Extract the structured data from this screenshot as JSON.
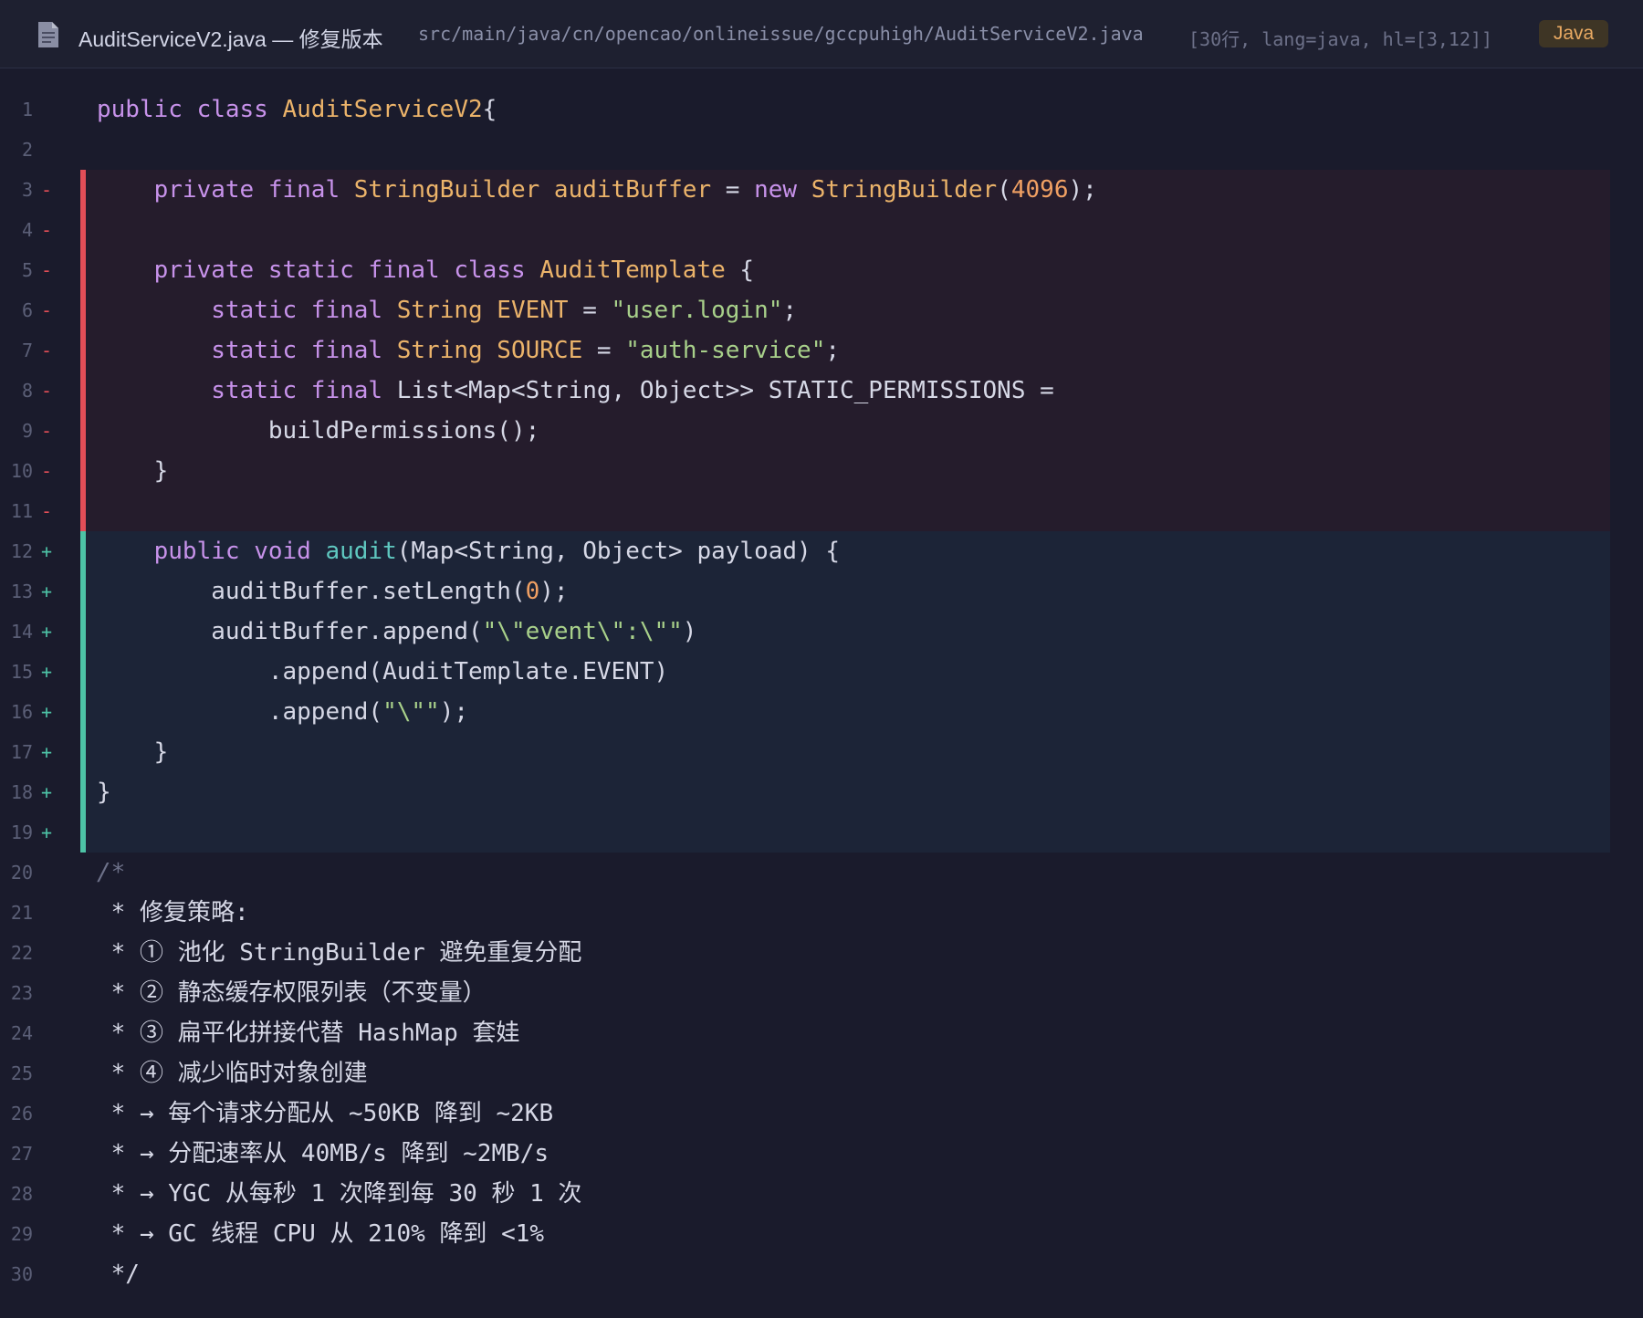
{
  "header": {
    "icon": "file-icon",
    "title": "AuditServiceV2.java — 修复版本",
    "path": "src/main/java/cn/opencao/onlineissue/gccpuhigh/AuditServiceV2.java",
    "meta": "[30行, lang=java, hl=[3,12]]",
    "language": "Java"
  },
  "colors": {
    "background": "#1a1b2c",
    "removed": "#e24e57",
    "added": "#4dc3a6",
    "keyword": "#c792ea",
    "type": "#ebb36a",
    "string": "#a8d08a"
  },
  "lines": [
    {
      "n": "1",
      "m": "",
      "kind": "ctx",
      "tokens": [
        [
          "kw",
          "public class "
        ],
        [
          "ty",
          "AuditServiceV2"
        ],
        [
          "",
          "{"
        ]
      ]
    },
    {
      "n": "2",
      "m": "",
      "kind": "ctx",
      "tokens": []
    },
    {
      "n": "3",
      "m": "-",
      "kind": "del",
      "tokens": [
        [
          "",
          "    "
        ],
        [
          "kw",
          "private final "
        ],
        [
          "ty",
          "StringBuilder auditBuffer"
        ],
        [
          "",
          " = "
        ],
        [
          "kw",
          "new "
        ],
        [
          "ty",
          "StringBuilder"
        ],
        [
          "",
          "("
        ],
        [
          "nu",
          "4096"
        ],
        [
          "",
          ");"
        ]
      ]
    },
    {
      "n": "4",
      "m": "-",
      "kind": "del",
      "tokens": []
    },
    {
      "n": "5",
      "m": "-",
      "kind": "del",
      "tokens": [
        [
          "",
          "    "
        ],
        [
          "kw",
          "private static final class "
        ],
        [
          "ty",
          "AuditTemplate"
        ],
        [
          "",
          " {"
        ]
      ]
    },
    {
      "n": "6",
      "m": "-",
      "kind": "del",
      "tokens": [
        [
          "",
          "        "
        ],
        [
          "kw",
          "static final "
        ],
        [
          "ty",
          "String EVENT"
        ],
        [
          "",
          " = "
        ],
        [
          "st",
          "\"user.login\""
        ],
        [
          "",
          ";"
        ]
      ]
    },
    {
      "n": "7",
      "m": "-",
      "kind": "del",
      "tokens": [
        [
          "",
          "        "
        ],
        [
          "kw",
          "static final "
        ],
        [
          "ty",
          "String SOURCE"
        ],
        [
          "",
          " = "
        ],
        [
          "st",
          "\"auth-service\""
        ],
        [
          "",
          ";"
        ]
      ]
    },
    {
      "n": "8",
      "m": "-",
      "kind": "del",
      "tokens": [
        [
          "",
          "        "
        ],
        [
          "kw",
          "static final "
        ],
        [
          "",
          "List<Map<String, Object>> STATIC_PERMISSIONS ="
        ]
      ]
    },
    {
      "n": "9",
      "m": "-",
      "kind": "del",
      "tokens": [
        [
          "",
          "            buildPermissions();"
        ]
      ]
    },
    {
      "n": "10",
      "m": "-",
      "kind": "del",
      "tokens": [
        [
          "",
          "    }"
        ]
      ]
    },
    {
      "n": "11",
      "m": "-",
      "kind": "del",
      "tokens": []
    },
    {
      "n": "12",
      "m": "+",
      "kind": "add",
      "tokens": [
        [
          "",
          "    "
        ],
        [
          "kw",
          "public void "
        ],
        [
          "fn",
          "audit"
        ],
        [
          "",
          "(Map<String, Object> payload) {"
        ]
      ]
    },
    {
      "n": "13",
      "m": "+",
      "kind": "add",
      "tokens": [
        [
          "",
          "        auditBuffer.setLength("
        ],
        [
          "nu",
          "0"
        ],
        [
          "",
          ");"
        ]
      ]
    },
    {
      "n": "14",
      "m": "+",
      "kind": "add",
      "tokens": [
        [
          "",
          "        auditBuffer.append("
        ],
        [
          "st",
          "\"\\\"event\\\":\\\"\""
        ],
        [
          "",
          ")"
        ]
      ]
    },
    {
      "n": "15",
      "m": "+",
      "kind": "add",
      "tokens": [
        [
          "",
          "            .append(AuditTemplate.EVENT)"
        ]
      ]
    },
    {
      "n": "16",
      "m": "+",
      "kind": "add",
      "tokens": [
        [
          "",
          "            .append("
        ],
        [
          "st",
          "\"\\\"\""
        ],
        [
          "",
          ");"
        ]
      ]
    },
    {
      "n": "17",
      "m": "+",
      "kind": "add",
      "tokens": [
        [
          "",
          "    }"
        ]
      ]
    },
    {
      "n": "18",
      "m": "+",
      "kind": "add",
      "tokens": [
        [
          "",
          "}"
        ]
      ]
    },
    {
      "n": "19",
      "m": "+",
      "kind": "add",
      "tokens": []
    },
    {
      "n": "20",
      "m": "",
      "kind": "ctx",
      "tokens": [
        [
          "cm",
          "/*"
        ]
      ]
    },
    {
      "n": "21",
      "m": "",
      "kind": "ctx",
      "tokens": [
        [
          "ct",
          " * 修复策略:"
        ]
      ]
    },
    {
      "n": "22",
      "m": "",
      "kind": "ctx",
      "tokens": [
        [
          "ct",
          " * ① 池化 StringBuilder 避免重复分配"
        ]
      ]
    },
    {
      "n": "23",
      "m": "",
      "kind": "ctx",
      "tokens": [
        [
          "ct",
          " * ② 静态缓存权限列表（不变量）"
        ]
      ]
    },
    {
      "n": "24",
      "m": "",
      "kind": "ctx",
      "tokens": [
        [
          "ct",
          " * ③ 扁平化拼接代替 HashMap 套娃"
        ]
      ]
    },
    {
      "n": "25",
      "m": "",
      "kind": "ctx",
      "tokens": [
        [
          "ct",
          " * ④ 减少临时对象创建"
        ]
      ]
    },
    {
      "n": "26",
      "m": "",
      "kind": "ctx",
      "tokens": [
        [
          "ct",
          " * → 每个请求分配从 ~50KB 降到 ~2KB"
        ]
      ]
    },
    {
      "n": "27",
      "m": "",
      "kind": "ctx",
      "tokens": [
        [
          "ct",
          " * → 分配速率从 40MB/s 降到 ~2MB/s"
        ]
      ]
    },
    {
      "n": "28",
      "m": "",
      "kind": "ctx",
      "tokens": [
        [
          "ct",
          " * → YGC 从每秒 1 次降到每 30 秒 1 次"
        ]
      ]
    },
    {
      "n": "29",
      "m": "",
      "kind": "ctx",
      "tokens": [
        [
          "ct",
          " * → GC 线程 CPU 从 210% 降到 <1%"
        ]
      ]
    },
    {
      "n": "30",
      "m": "",
      "kind": "ctx",
      "tokens": [
        [
          "ct",
          " */"
        ]
      ]
    }
  ]
}
